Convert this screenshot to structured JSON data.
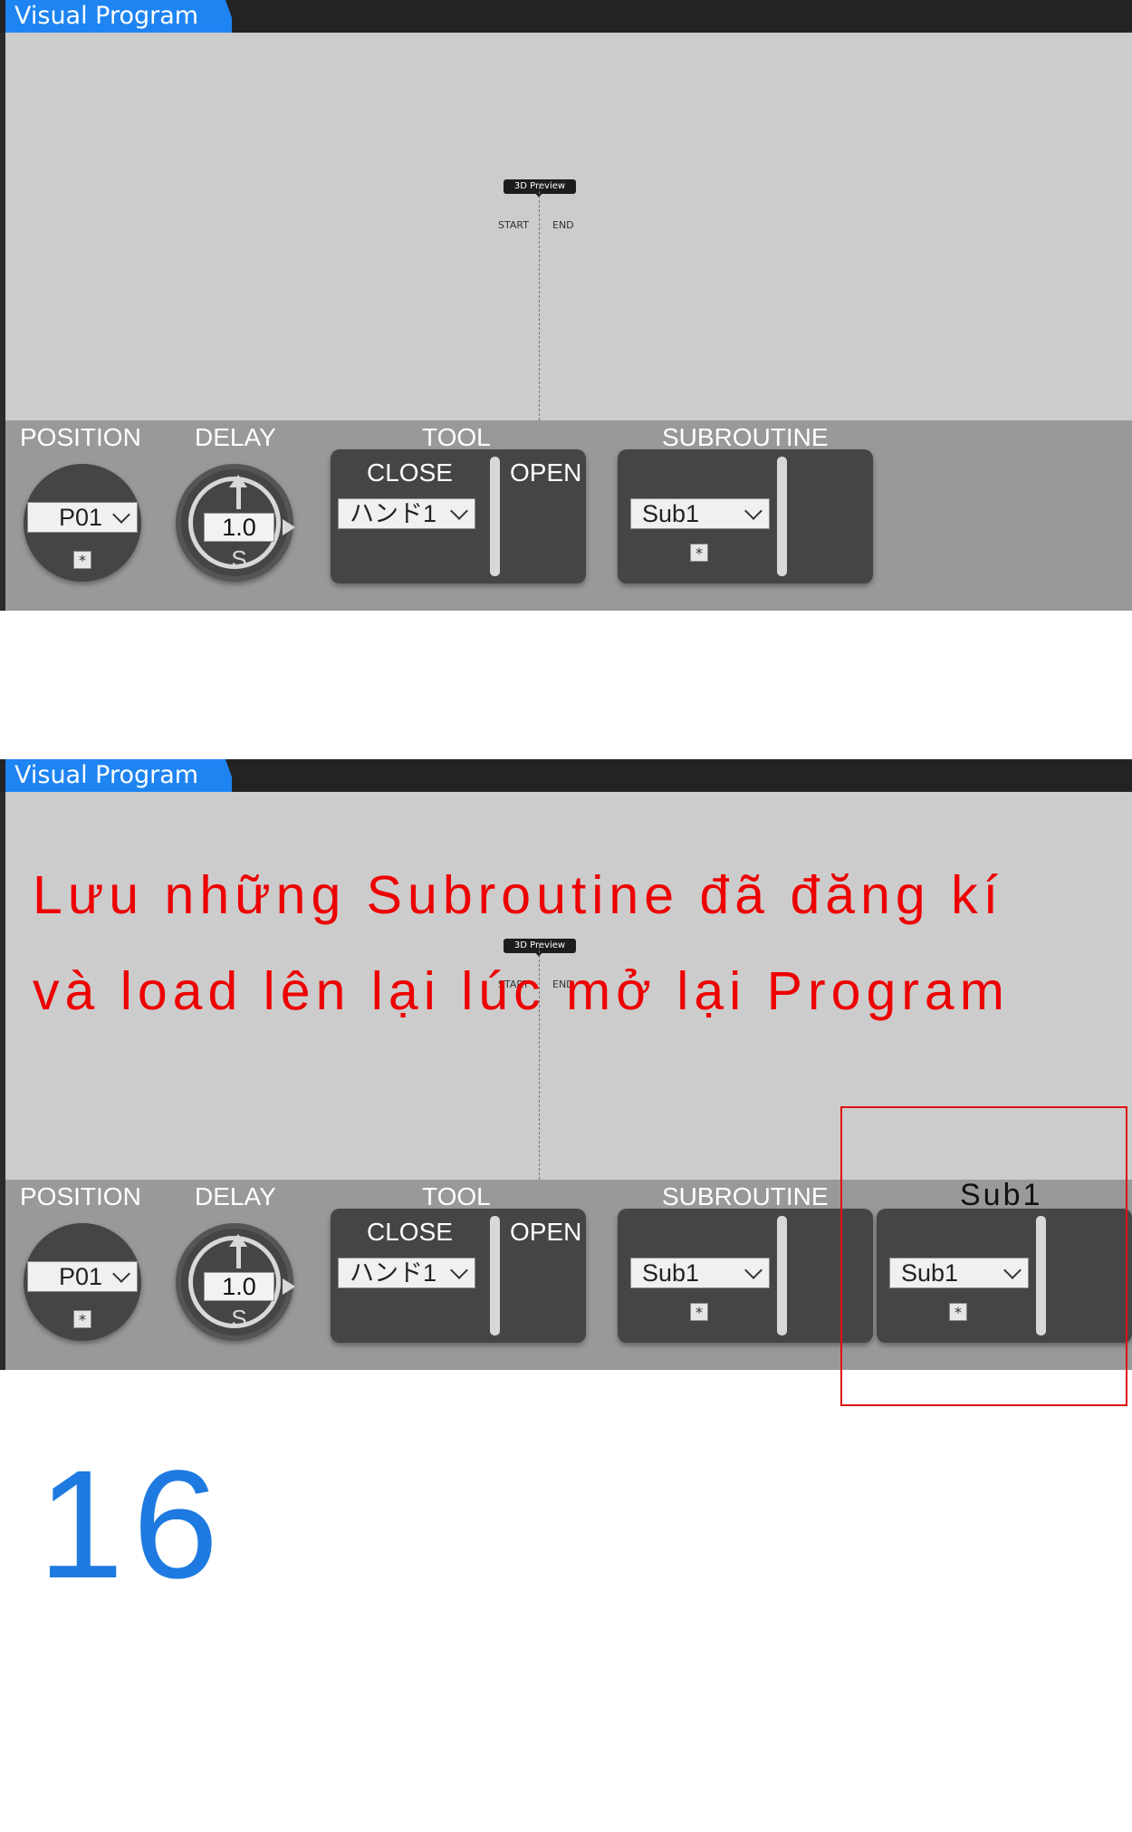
{
  "window": {
    "title": "Visual Program"
  },
  "canvas": {
    "preview_label": "3D Preview",
    "start_label": "START",
    "end_label": "END"
  },
  "palette": {
    "position_label": "POSITION",
    "delay_label": "DELAY",
    "tool_label": "TOOL",
    "subroutine_label": "SUBROUTINE",
    "position_value": "P01",
    "position_button": "*",
    "delay_value": "1.0",
    "delay_unit": "S",
    "tool_close": "CLOSE",
    "tool_open": "OPEN",
    "tool_value": "ハンド1",
    "subroutine_value": "Sub1",
    "subroutine_button": "*"
  },
  "bottom": {
    "sub2_title": "Sub1",
    "sub2_value": "Sub1",
    "sub2_button": "*"
  },
  "annotation": {
    "line1": "Lưu những Subroutine đã đăng kí",
    "line2": "và load lên lại lúc mở lại Program"
  },
  "page_number": "16",
  "colors": {
    "title_tab": "#1e84f2",
    "annotation": "#ee0000",
    "page_number": "#1e7ae0"
  }
}
